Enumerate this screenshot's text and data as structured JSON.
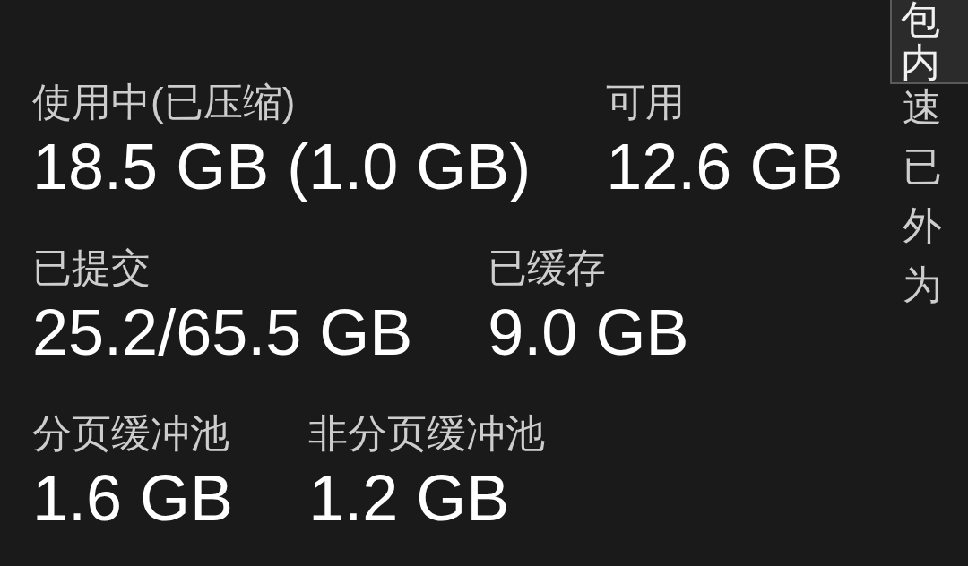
{
  "stat_rows": [
    [
      {
        "label": "使用中(已压缩)",
        "value": "18.5 GB (1.0 GB)"
      },
      {
        "label": "可用",
        "value": "12.6 GB"
      }
    ],
    [
      {
        "label": "已提交",
        "value": "25.2/65.5 GB"
      },
      {
        "label": "已缓存",
        "value": "9.0 GB"
      }
    ],
    [
      {
        "label": "分页缓冲池",
        "value": "1.6 GB"
      },
      {
        "label": "非分页缓冲池",
        "value": "1.2 GB"
      }
    ]
  ],
  "side_labels": [
    "速",
    "已",
    "外",
    "为"
  ],
  "tooltip": {
    "lines": [
      "包",
      "内"
    ]
  }
}
